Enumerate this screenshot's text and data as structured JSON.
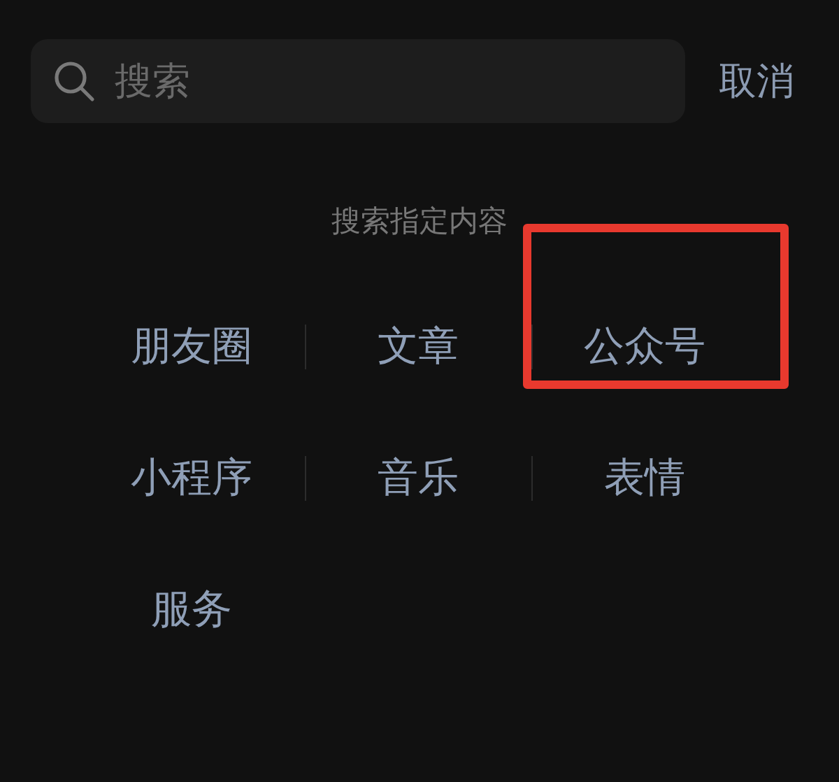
{
  "search": {
    "placeholder": "搜索"
  },
  "cancel": "取消",
  "section_title": "搜索指定内容",
  "items": [
    {
      "label": "朋友圈",
      "highlighted": false
    },
    {
      "label": "文章",
      "highlighted": false
    },
    {
      "label": "公众号",
      "highlighted": true
    },
    {
      "label": "小程序",
      "highlighted": false
    },
    {
      "label": "音乐",
      "highlighted": false
    },
    {
      "label": "表情",
      "highlighted": false
    },
    {
      "label": "服务",
      "highlighted": false
    }
  ]
}
